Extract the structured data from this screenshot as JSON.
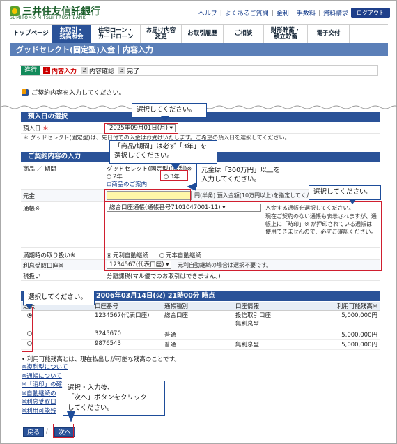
{
  "header": {
    "logo_text": "三井住友信託銀行",
    "logo_sub": "SUMITOMO MITSUI TRUST BANK",
    "links": [
      "ヘルプ",
      "よくあるご質問",
      "金利",
      "手数料",
      "資料請求"
    ],
    "logout": "ログアウト"
  },
  "nav": {
    "items": [
      {
        "label": "トップページ"
      },
      {
        "label": "お取引・\n残高照会"
      },
      {
        "label": "住宅ローン・\nカードローン"
      },
      {
        "label": "お届け内容\n変更"
      },
      {
        "label": "お取引履歴"
      },
      {
        "label": "ご相談"
      },
      {
        "label": "財形貯蓄・\n積立貯蓄"
      },
      {
        "label": "電子交付"
      }
    ]
  },
  "page_title": "グッドセレクト(固定型)入金｜内容入力",
  "steps": {
    "go": "進行",
    "s1_num": "1",
    "s1": "内容入力",
    "s2_num": "2",
    "s2": "内容確認",
    "s3_num": "3",
    "s3": "完了"
  },
  "intro": "ご契約内容を入力してください。",
  "deposit_date": {
    "section": "預入日の選択",
    "label": "預入日",
    "required": "＊",
    "value": "2025年09月01日(月)",
    "note": "＊ グッドセレクト(固定型)は、先日付での入金はお受けいたします。ご希望の預入日を選択してください。"
  },
  "contract": {
    "section": "ご契約内容の入力",
    "product_label": "商品 ／ 期間",
    "product_value": "グッドセレクト(固定型)(複利)※",
    "term_2": "2年",
    "term_3": "3年",
    "product_link": "商品のご案内",
    "amount_label": "元金",
    "amount_hint": "円(半角) 預入金額(10万円以上)を指定してください。",
    "account_label": "通帳※",
    "account_value": "総合口座通帳(通帳番号7101047001-11)",
    "account_hint": "入金する通帳を選択してください。",
    "account_note": "現在ご契約のない通帳も表示されますが、通帳上に「時印」※ が押印されている通帳は使用できませんので、必ずご確認ください。",
    "maturity_label": "満期時の取り扱い※",
    "maturity_opt1": "元利自動継続",
    "maturity_opt2": "元本自動継続",
    "interest_label": "利息受取口座※",
    "interest_value": "1234567(代表口座)",
    "interest_note": "元利自動継続の場合は選択不要です。",
    "tax_label": "税扱い",
    "tax_value": "分離課税(マル優でのお取引はできません。)"
  },
  "accounts": {
    "section_title": "2006年03月14日(火) 21時00分 時点",
    "headers": [
      "選択",
      "口座番号",
      "通帳種別",
      "口座情報",
      "利用可能残高※"
    ],
    "rows": [
      {
        "no": "1234567(代表口座)",
        "type": "総合口座",
        "info": "投信取引口座",
        "info2": "無利息型",
        "balance": "5,000,000円"
      },
      {
        "no": "3245670",
        "type": "普通",
        "info": "",
        "info2": "",
        "balance": "5,000,000円"
      },
      {
        "no": "9876543",
        "type": "普通",
        "info": "無利息型",
        "info2": "",
        "balance": "5,000,000円"
      }
    ],
    "footnote": "• 利用可能残高とは、現在払出しが可能な残高のことです。"
  },
  "links": [
    "※複利型について",
    "※通帳について",
    "※「消印」の確",
    "※自動継続の",
    "※利息受取口",
    "※利用可能残"
  ],
  "buttons": {
    "back": "戻る",
    "next": "次へ"
  },
  "callouts": {
    "c1": "選択してください。",
    "c2": "「商品/期間」は必ず「3年」を\n選択してください。",
    "c3": "元金は「300万円」以上を\n入力してください。",
    "c4": "選択してください。",
    "c5": "選択してください。",
    "c6": "選択・入力後、\n「次へ」ボタンをクリック\nしてください。"
  }
}
